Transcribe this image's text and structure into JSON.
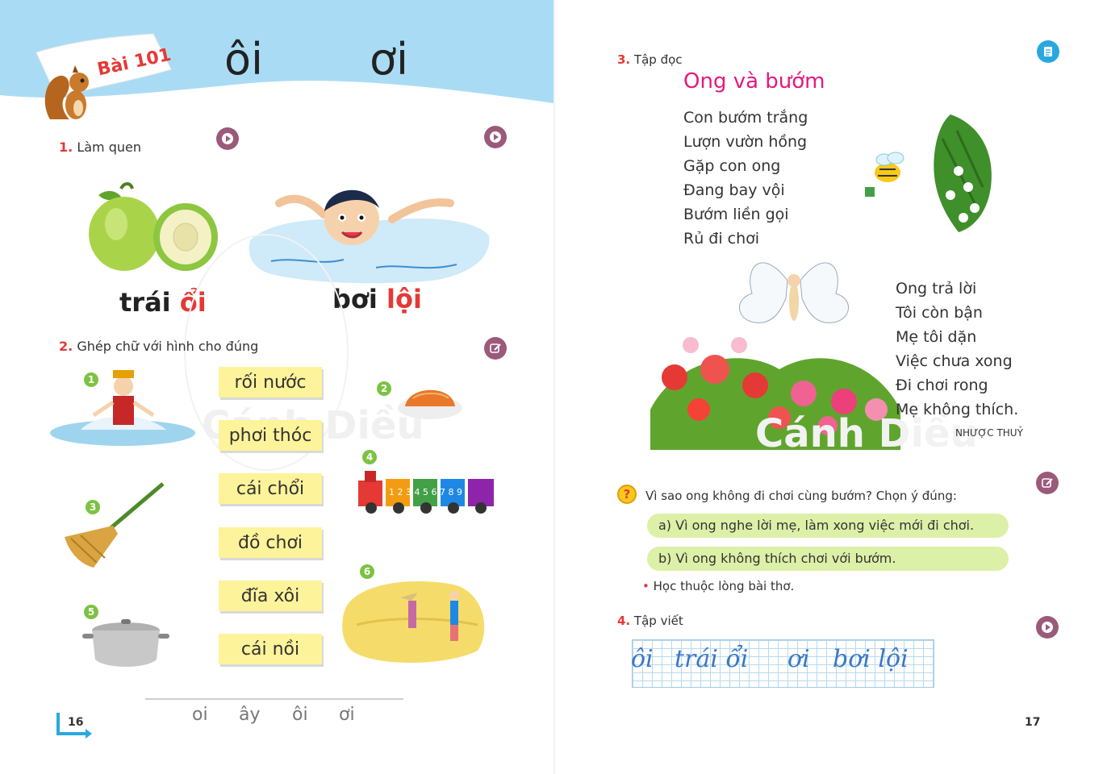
{
  "left": {
    "lesson_label": "Bài 101",
    "title_vowels": [
      "ôi",
      "ơi"
    ],
    "section1": {
      "num": "1.",
      "label": "Làm quen"
    },
    "words_intro": [
      {
        "plain": "trái ",
        "highlight": "ổi"
      },
      {
        "plain": "bơi ",
        "highlight": "lội"
      }
    ],
    "section2": {
      "num": "2.",
      "label": "Ghép chữ với hình cho đúng"
    },
    "word_cards": [
      "rối nước",
      "phơi thóc",
      "cái chổi",
      "đồ chơi",
      "đĩa xôi",
      "cái nồi"
    ],
    "badges": [
      "1",
      "2",
      "3",
      "4",
      "5",
      "6"
    ],
    "train_numbers": "1 2 3 4 5 6 7 8 9",
    "bottom_vowels": [
      "oi",
      "ây",
      "ôi",
      "ơi"
    ],
    "page_number": "16",
    "watermark": "Cánh Diều"
  },
  "right": {
    "section3": {
      "num": "3.",
      "label": "Tập đọc"
    },
    "poem_title": "Ong và bướm",
    "stanza1": [
      "Con bướm trắng",
      "Lượn vườn hồng",
      "Gặp con ong",
      "Đang bay vội",
      "Bướm liền gọi",
      "Rủ đi chơi"
    ],
    "stanza2": [
      "Ong trả lời",
      "Tôi còn bận",
      "Mẹ tôi dặn",
      "Việc chưa xong",
      "Đi chơi rong",
      "Mẹ không thích."
    ],
    "author": "NHƯỢC THUỶ",
    "question_mark": "?",
    "question": "Vì sao ong không đi chơi cùng bướm? Chọn ý đúng:",
    "answers": [
      "a) Vì ong nghe lời mẹ, làm xong việc mới đi chơi.",
      "b) Vì ong không thích chơi với bướm."
    ],
    "memorize_bullet": "•",
    "memorize": "Học thuộc lòng bài thơ.",
    "section4": {
      "num": "4.",
      "label": "Tập viết"
    },
    "writing": [
      "ôi",
      "trái ổi",
      "ơi",
      "bơi lội"
    ],
    "page_number": "17",
    "watermark": "Cánh Diều"
  },
  "colors": {
    "header_blue": "#a9dcf4",
    "pink": "#e6197d",
    "red": "#e53935",
    "button": "#9b5a7a",
    "card_yellow": "#fdf39a",
    "answer_green": "#ddf0a8"
  },
  "icons": [
    "play-icon",
    "edit-icon",
    "document-icon",
    "question-icon"
  ]
}
